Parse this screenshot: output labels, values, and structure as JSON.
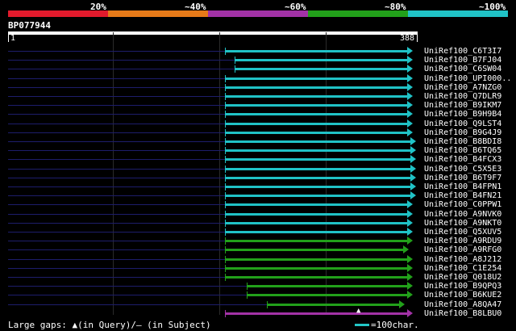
{
  "legend": {
    "labels": [
      "20%",
      "~40%",
      "~60%",
      "~80%",
      "~100%"
    ],
    "colors": [
      "#e21a2c",
      "#e67a19",
      "#a232a6",
      "#22a01a",
      "#20c2c6"
    ]
  },
  "query": {
    "title": "BP077944",
    "start": "1",
    "end": "388"
  },
  "hits": [
    {
      "name": "UniRef100_C6T3I7",
      "color": "#20c2c6"
    },
    {
      "name": "UniRef100_B7FJ04",
      "color": "#20c2c6"
    },
    {
      "name": "UniRef100_C6SW04",
      "color": "#20c2c6"
    },
    {
      "name": "UniRef100_UPI000..",
      "color": "#20c2c6"
    },
    {
      "name": "UniRef100_A7NZG0",
      "color": "#20c2c6"
    },
    {
      "name": "UniRef100_Q7DLR9",
      "color": "#20c2c6"
    },
    {
      "name": "UniRef100_B9IKM7",
      "color": "#20c2c6"
    },
    {
      "name": "UniRef100_B9H9B4",
      "color": "#20c2c6"
    },
    {
      "name": "UniRef100_Q9LST4",
      "color": "#20c2c6"
    },
    {
      "name": "UniRef100_B9G4J9",
      "color": "#20c2c6"
    },
    {
      "name": "UniRef100_B8BDI8",
      "color": "#20c2c6"
    },
    {
      "name": "UniRef100_B6TQ65",
      "color": "#20c2c6"
    },
    {
      "name": "UniRef100_B4FCX3",
      "color": "#20c2c6"
    },
    {
      "name": "UniRef100_C5X5E3",
      "color": "#20c2c6"
    },
    {
      "name": "UniRef100_B6T9F7",
      "color": "#20c2c6"
    },
    {
      "name": "UniRef100_B4FPN1",
      "color": "#20c2c6"
    },
    {
      "name": "UniRef100_B4FN21",
      "color": "#20c2c6"
    },
    {
      "name": "UniRef100_C0PPW1",
      "color": "#20c2c6"
    },
    {
      "name": "UniRef100_A9NVK0",
      "color": "#20c2c6"
    },
    {
      "name": "UniRef100_A9NKT0",
      "color": "#20c2c6"
    },
    {
      "name": "UniRef100_Q5XUV5",
      "color": "#20c2c6"
    },
    {
      "name": "UniRef100_A9RDU9",
      "color": "#22a01a"
    },
    {
      "name": "UniRef100_A9RFG0",
      "color": "#22a01a"
    },
    {
      "name": "UniRef100_A8J212",
      "color": "#22a01a"
    },
    {
      "name": "UniRef100_C1E254",
      "color": "#22a01a"
    },
    {
      "name": "UniRef100_Q018U2",
      "color": "#22a01a"
    },
    {
      "name": "UniRef100_B9QPQ3",
      "color": "#22a01a"
    },
    {
      "name": "UniRef100_B6KUE2",
      "color": "#22a01a"
    },
    {
      "name": "UniRef100_A8QA47",
      "color": "#22a01a"
    },
    {
      "name": "UniRef100_B8LBU0",
      "color": "#a232a6"
    }
  ],
  "footer": {
    "large_gaps": "Large gaps: ▲(in Query)/— (in Subject)",
    "scale": "=100char."
  }
}
